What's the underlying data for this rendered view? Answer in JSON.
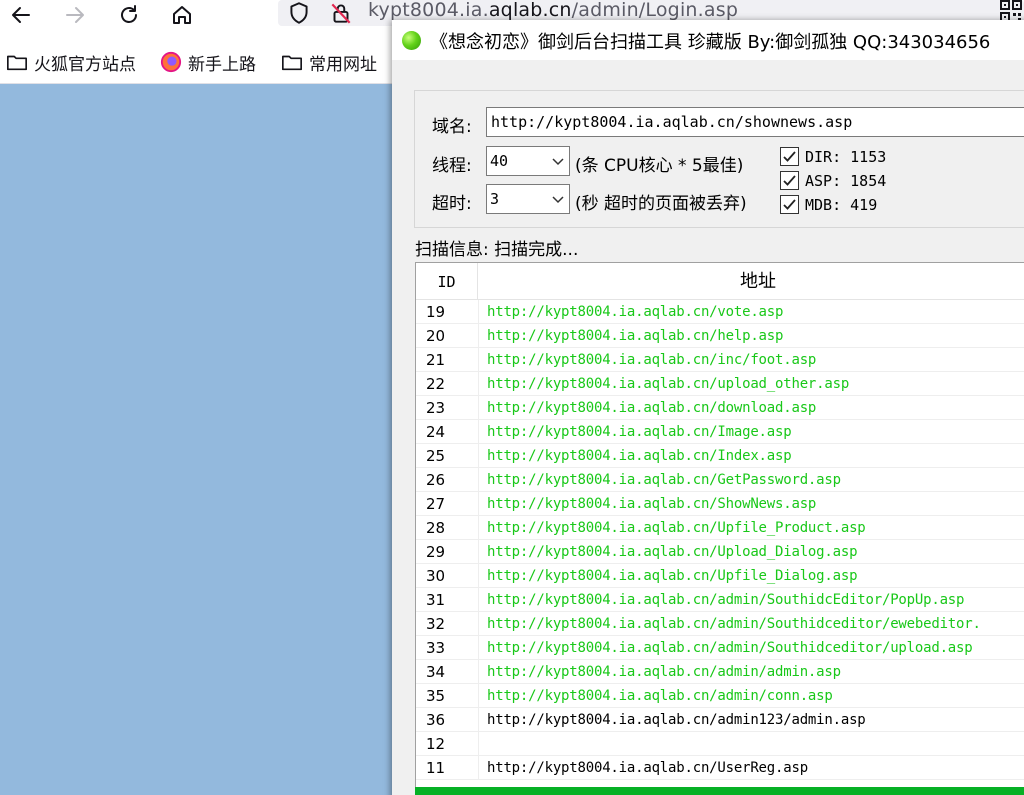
{
  "browser": {
    "url_prefix": "kypt8004.ia.",
    "url_host": "aqlab.cn",
    "url_path": "/admin/Login.asp",
    "bookmarks": [
      {
        "label": "火狐官方站点",
        "icon": "folder-icon"
      },
      {
        "label": "新手上路",
        "icon": "firefox-icon"
      },
      {
        "label": "常用网址",
        "icon": "folder-icon"
      }
    ]
  },
  "window": {
    "title": "《想念初恋》御剑后台扫描工具 珍藏版 By:御剑孤独 QQ:343034656"
  },
  "config": {
    "domain_label": "域名:",
    "domain_value": "http://kypt8004.ia.aqlab.cn/shownews.asp",
    "threads_label": "线程:",
    "threads_value": "40",
    "threads_hint": "(条 CPU核心 * 5最佳)",
    "timeout_label": "超时:",
    "timeout_value": "3",
    "timeout_hint": "(秒 超时的页面被丢弃)",
    "checks": [
      {
        "label": "DIR: 1153",
        "checked": true
      },
      {
        "label": "ASP: 1854",
        "checked": true
      },
      {
        "label": "MDB: 419",
        "checked": true
      }
    ]
  },
  "scan_info": "扫描信息: 扫描完成...",
  "results": {
    "header_id": "ID",
    "header_addr": "地址",
    "rows": [
      {
        "id": "19",
        "url": "http://kypt8004.ia.aqlab.cn/vote.asp",
        "color": "#19c819"
      },
      {
        "id": "20",
        "url": "http://kypt8004.ia.aqlab.cn/help.asp",
        "color": "#19c819"
      },
      {
        "id": "21",
        "url": "http://kypt8004.ia.aqlab.cn/inc/foot.asp",
        "color": "#19c819"
      },
      {
        "id": "22",
        "url": "http://kypt8004.ia.aqlab.cn/upload_other.asp",
        "color": "#19c819"
      },
      {
        "id": "23",
        "url": "http://kypt8004.ia.aqlab.cn/download.asp",
        "color": "#19c819"
      },
      {
        "id": "24",
        "url": "http://kypt8004.ia.aqlab.cn/Image.asp",
        "color": "#19c819"
      },
      {
        "id": "25",
        "url": "http://kypt8004.ia.aqlab.cn/Index.asp",
        "color": "#19c819"
      },
      {
        "id": "26",
        "url": "http://kypt8004.ia.aqlab.cn/GetPassword.asp",
        "color": "#19c819"
      },
      {
        "id": "27",
        "url": "http://kypt8004.ia.aqlab.cn/ShowNews.asp",
        "color": "#19c819"
      },
      {
        "id": "28",
        "url": "http://kypt8004.ia.aqlab.cn/Upfile_Product.asp",
        "color": "#19c819"
      },
      {
        "id": "29",
        "url": "http://kypt8004.ia.aqlab.cn/Upload_Dialog.asp",
        "color": "#19c819"
      },
      {
        "id": "30",
        "url": "http://kypt8004.ia.aqlab.cn/Upfile_Dialog.asp",
        "color": "#19c819"
      },
      {
        "id": "31",
        "url": "http://kypt8004.ia.aqlab.cn/admin/SouthidcEditor/PopUp.asp",
        "color": "#19c819"
      },
      {
        "id": "32",
        "url": "http://kypt8004.ia.aqlab.cn/admin/Southidceditor/ewebeditor.",
        "color": "#19c819"
      },
      {
        "id": "33",
        "url": "http://kypt8004.ia.aqlab.cn/admin/Southidceditor/upload.asp",
        "color": "#19c819"
      },
      {
        "id": "34",
        "url": "http://kypt8004.ia.aqlab.cn/admin/admin.asp",
        "color": "#19c819"
      },
      {
        "id": "35",
        "url": "http://kypt8004.ia.aqlab.cn/admin/conn.asp",
        "color": "#19c819"
      },
      {
        "id": "36",
        "url": "http://kypt8004.ia.aqlab.cn/admin123/admin.asp",
        "color": "#000000"
      },
      {
        "id": "12",
        "url": "",
        "color": "#000000"
      },
      {
        "id": "11",
        "url": "http://kypt8004.ia.aqlab.cn/UserReg.asp",
        "color": "#000000"
      }
    ]
  },
  "colors": {
    "desktop": "#93b9dd",
    "found_url": "#19c819",
    "progress": "#06b025"
  }
}
